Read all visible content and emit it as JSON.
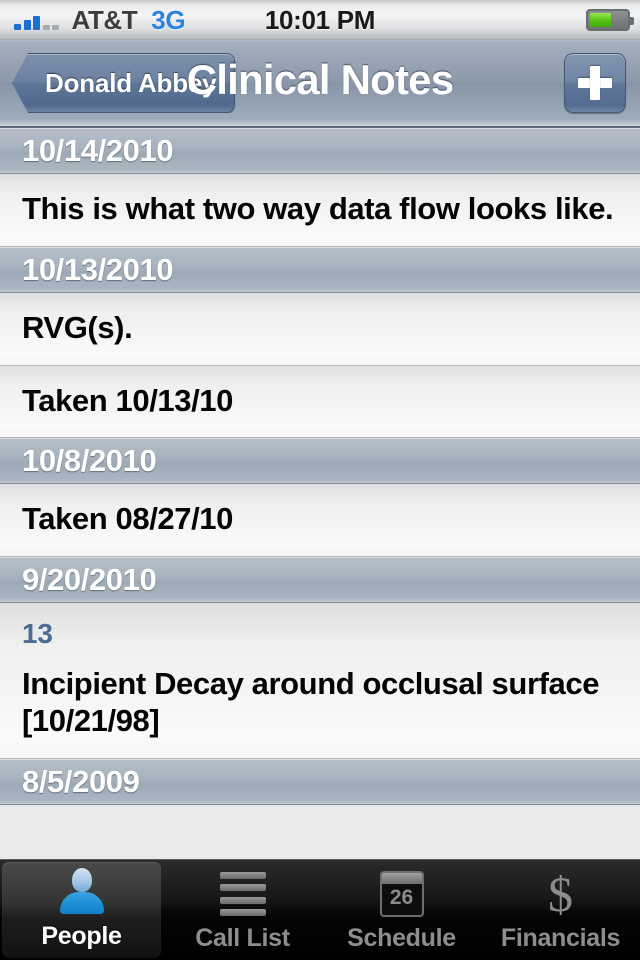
{
  "status_bar": {
    "carrier": "AT&T",
    "network": "3G",
    "time": "10:01 PM",
    "signal_bars_filled": 3,
    "signal_bars_total": 5,
    "battery_percent": 58
  },
  "nav_bar": {
    "back_label": "Donald Abbey",
    "title": "Clinical Notes",
    "add_label": "+"
  },
  "list": {
    "sections": [
      {
        "date": "10/14/2010",
        "rows": [
          {
            "sub": "",
            "text": "This is what two way data flow looks like."
          }
        ]
      },
      {
        "date": "10/13/2010",
        "rows": [
          {
            "sub": "",
            "text": "RVG(s)."
          },
          {
            "sub": "",
            "text": "Taken 10/13/10"
          }
        ]
      },
      {
        "date": "10/8/2010",
        "rows": [
          {
            "sub": "",
            "text": "Taken 08/27/10"
          }
        ]
      },
      {
        "date": "9/20/2010",
        "rows": [
          {
            "sub": "13",
            "text": "Incipient Decay around occlusal surface [10/21/98]"
          }
        ]
      },
      {
        "date": "8/5/2009",
        "rows": []
      }
    ]
  },
  "tab_bar": {
    "tabs": [
      {
        "label": "People",
        "icon": "person-icon",
        "active": true
      },
      {
        "label": "Call List",
        "icon": "list-lines-icon",
        "active": false
      },
      {
        "label": "Schedule",
        "icon": "calendar-icon",
        "active": false,
        "day": "26"
      },
      {
        "label": "Financials",
        "icon": "dollar-icon",
        "active": false
      }
    ]
  },
  "colors": {
    "accent_blue": "#2e83e0",
    "nav_blue_gray": "#8795a8",
    "section_header": "#9daab6",
    "sub_text_blue": "#4d6c92",
    "battery_green": "#56c416"
  }
}
